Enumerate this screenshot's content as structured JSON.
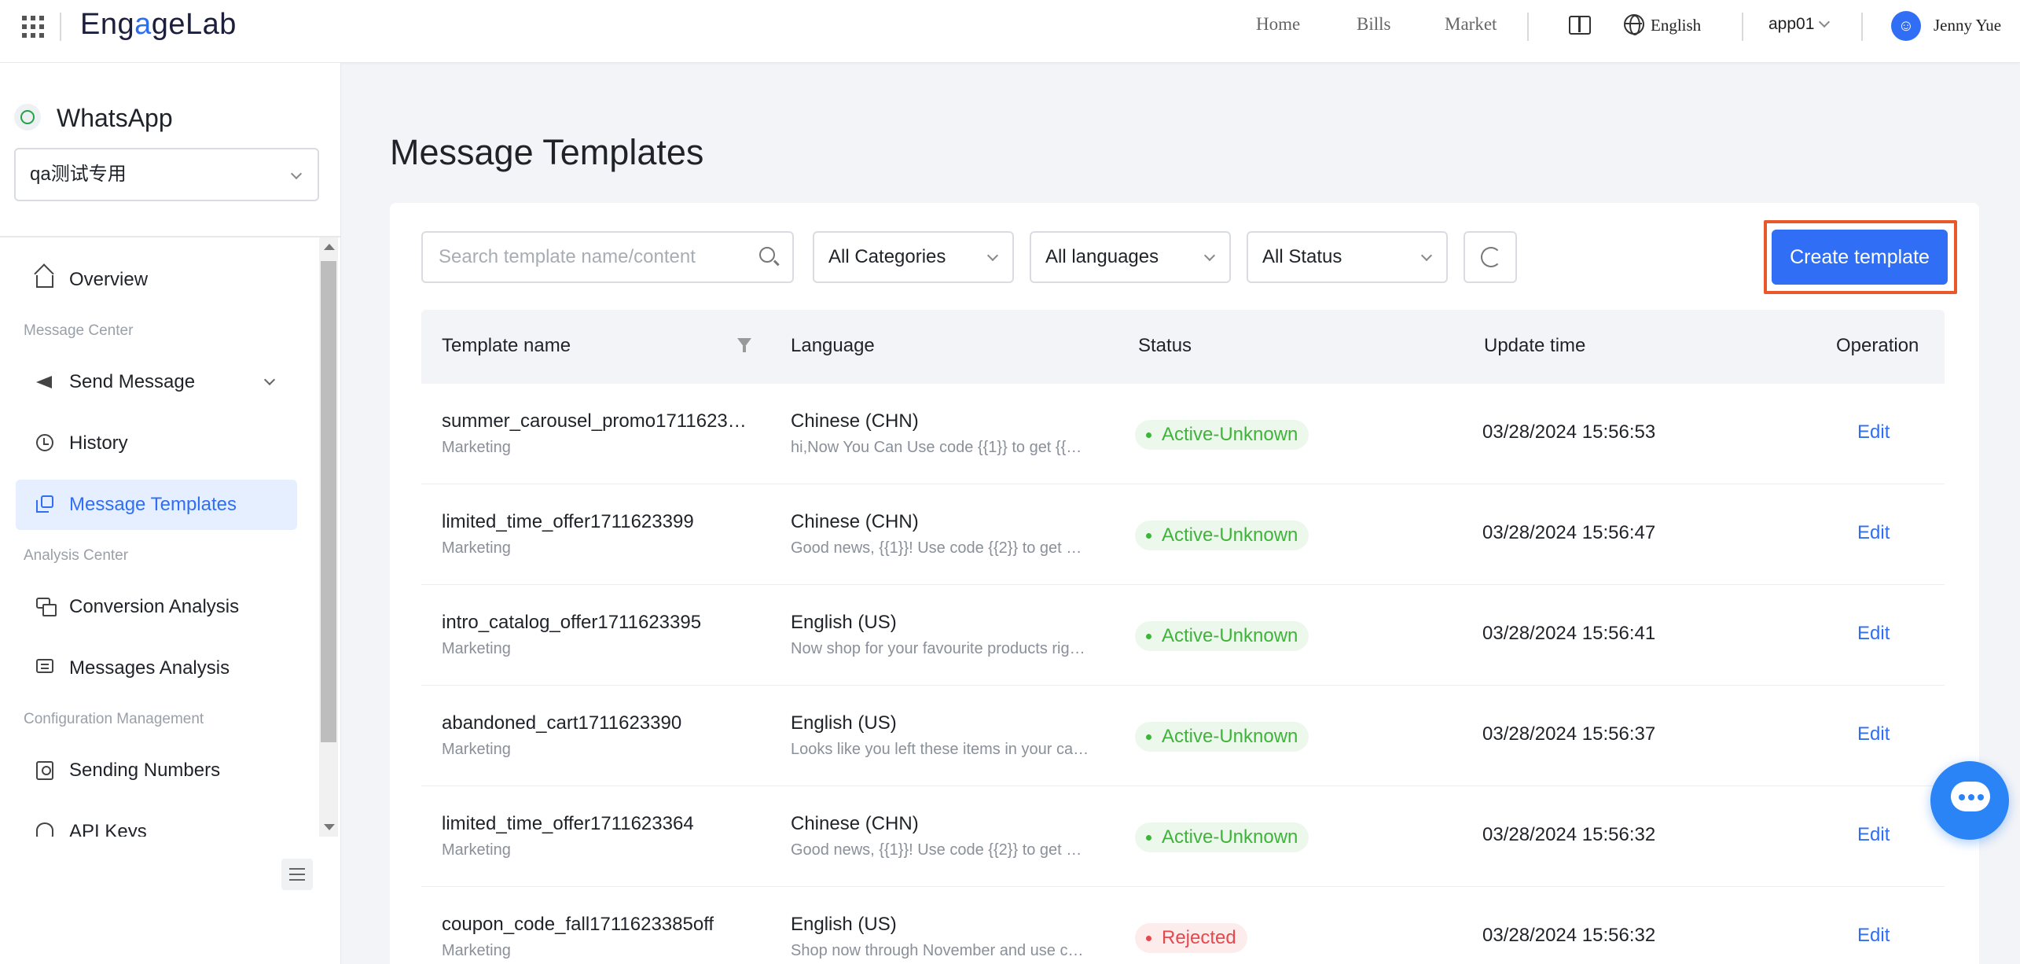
{
  "topbar": {
    "logo": {
      "part1": "Eng",
      "part2": "a",
      "part3": "geLab"
    },
    "nav": [
      "Home",
      "Bills",
      "Market"
    ],
    "language": "English",
    "app": "app01",
    "user": "Jenny Yue",
    "icons": [
      "apps-grid-icon",
      "book-icon",
      "globe-icon",
      "user-icon",
      "chevron-down-icon"
    ]
  },
  "sidebar": {
    "product": "WhatsApp",
    "project": "qa测试专用",
    "items": {
      "overview": "Overview",
      "group_message": "Message Center",
      "send_message": "Send Message",
      "history": "History",
      "templates": "Message Templates",
      "group_analysis": "Analysis Center",
      "conversion": "Conversion Analysis",
      "messages_analysis": "Messages Analysis",
      "group_config": "Configuration Management",
      "sending_numbers": "Sending Numbers",
      "api_keys": "API Keys"
    }
  },
  "main": {
    "title": "Message Templates",
    "search_placeholder": "Search template name/content",
    "filters": {
      "categories": "All Categories",
      "languages": "All languages",
      "status": "All Status"
    },
    "create_label": "Create template",
    "columns": {
      "name": "Template name",
      "language": "Language",
      "status": "Status",
      "update_time": "Update time",
      "operation": "Operation"
    },
    "rows": [
      {
        "name": "summer_carousel_promo1711623…",
        "category": "Marketing",
        "language": "Chinese (CHN)",
        "preview": "hi,Now You Can Use code {{1}} to get {{…",
        "status": "Active-Unknown",
        "status_type": "active",
        "time": "03/28/2024 15:56:53",
        "op": "Edit"
      },
      {
        "name": "limited_time_offer1711623399",
        "category": "Marketing",
        "language": "Chinese (CHN)",
        "preview": "Good news, {{1}}! Use code {{2}} to get …",
        "status": "Active-Unknown",
        "status_type": "active",
        "time": "03/28/2024 15:56:47",
        "op": "Edit"
      },
      {
        "name": "intro_catalog_offer1711623395",
        "category": "Marketing",
        "language": "English (US)",
        "preview": "Now shop for your favourite products rig…",
        "status": "Active-Unknown",
        "status_type": "active",
        "time": "03/28/2024 15:56:41",
        "op": "Edit"
      },
      {
        "name": "abandoned_cart1711623390",
        "category": "Marketing",
        "language": "English (US)",
        "preview": "Looks like you left these items in your ca…",
        "status": "Active-Unknown",
        "status_type": "active",
        "time": "03/28/2024 15:56:37",
        "op": "Edit"
      },
      {
        "name": "limited_time_offer1711623364",
        "category": "Marketing",
        "language": "Chinese (CHN)",
        "preview": "Good news, {{1}}! Use code {{2}} to get …",
        "status": "Active-Unknown",
        "status_type": "active",
        "time": "03/28/2024 15:56:32",
        "op": "Edit"
      },
      {
        "name": "coupon_code_fall1711623385off",
        "category": "Marketing",
        "language": "English (US)",
        "preview": "Shop now through November and use c…",
        "status": "Rejected",
        "status_type": "rejected",
        "time": "03/28/2024 15:56:32",
        "op": "Edit"
      }
    ]
  },
  "colors": {
    "accent": "#2f6ef5",
    "active": "#3fb33a",
    "rejected": "#e5484d",
    "highlight": "#e8582a"
  }
}
